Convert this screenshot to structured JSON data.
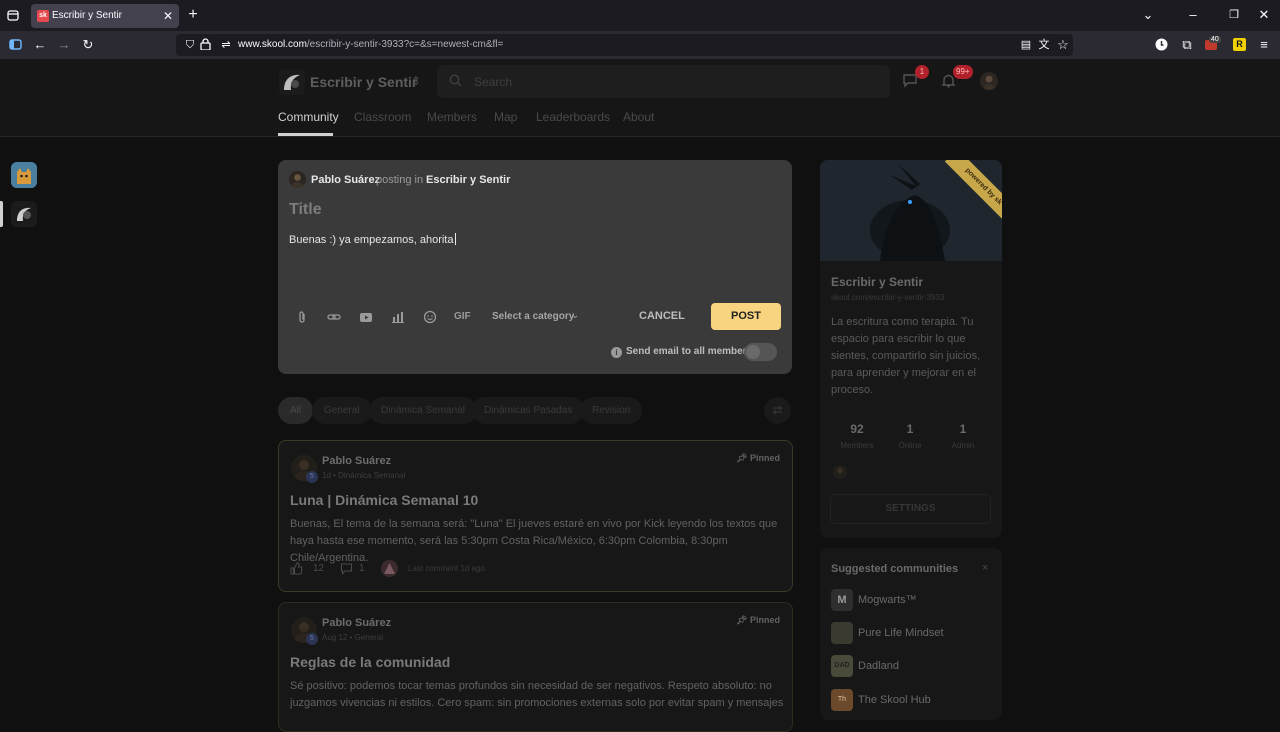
{
  "browser": {
    "tab_title": "Escribir y Sentir",
    "tab_favicon_text": "sk",
    "url_domain": "www.skool.com",
    "url_path": "/escribir-y-sentir-3933?c=&s=newest-cm&fl=",
    "extension_badge": "40",
    "extension_letter": "R"
  },
  "header": {
    "group_name": "Escribir y Sentir",
    "search_placeholder": "Search",
    "chat_badge": "1",
    "notif_badge": "99+",
    "tabs": [
      {
        "label": "Community"
      },
      {
        "label": "Classroom"
      },
      {
        "label": "Members"
      },
      {
        "label": "Map"
      },
      {
        "label": "Leaderboards"
      },
      {
        "label": "About"
      }
    ]
  },
  "composer": {
    "author": "Pablo Suárez",
    "posting_in": "posting in",
    "group": "Escribir y Sentir",
    "title_placeholder": "Title",
    "body_text": "Buenas :) ya empezamos, ahorita",
    "gif_label": "GIF",
    "category_label": "Select a category",
    "cancel_label": "CANCEL",
    "post_label": "POST",
    "email_label": "Send email to all members"
  },
  "filters": [
    "All",
    "General",
    "Dinámica Semanal",
    "Dinámicas Pasadas",
    "Revision"
  ],
  "posts": [
    {
      "author": "Pablo Suárez",
      "level": "5",
      "meta": "1d • Dinámica Semanal",
      "pinned": "Pinned",
      "title": "Luna | Dinámica Semanal 10",
      "body": "Buenas, El tema de la semana será: \"Luna\" El jueves estaré en vivo por Kick leyendo los textos que haya hasta ese momento, será las 5:30pm Costa Rica/México, 6:30pm Colombia, 8:30pm Chile/Argentina.",
      "likes": "12",
      "comments": "1",
      "last_comment": "Last comment 1d ago"
    },
    {
      "author": "Pablo Suárez",
      "level": "5",
      "meta": "Aug 12 • General",
      "pinned": "Pinned",
      "title": "Reglas de la comunidad",
      "body": "Sé positivo: podemos tocar temas profundos sin necesidad de ser negativos. Respeto absoluto: no juzgamos vivencias ni estilos. Cero spam: sin promociones externas solo por evitar spam y mensajes"
    }
  ],
  "about": {
    "ribbon": "powered by sk",
    "name": "Escribir y Sentir",
    "url": "skool.com/escribir-y-sentir-3933",
    "description": "La escritura como terapia. Tu espacio para escribir lo que sientes, compartirlo sin juicios, para aprender y mejorar en el proceso.",
    "stats": [
      {
        "value": "92",
        "label": "Members"
      },
      {
        "value": "1",
        "label": "Online"
      },
      {
        "value": "1",
        "label": "Admin"
      }
    ],
    "settings_label": "SETTINGS"
  },
  "suggested": {
    "title": "Suggested communities",
    "close": "×",
    "items": [
      {
        "name": "Mogwarts™",
        "icon_text": "M"
      },
      {
        "name": "Pure Life Mindset",
        "icon_text": ""
      },
      {
        "name": "Dadland",
        "icon_text": "DAD"
      },
      {
        "name": "The Skool Hub",
        "icon_text": "Th"
      }
    ]
  },
  "colors": {
    "accent": "#f8d481",
    "badge": "#b0212b",
    "background": "#101010"
  }
}
